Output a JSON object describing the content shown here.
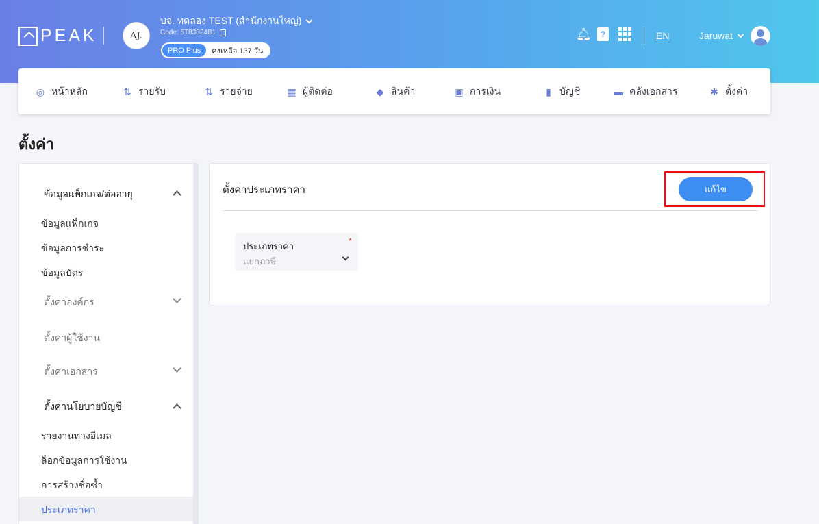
{
  "header": {
    "logo_text": "PEAK",
    "company_initials": "AJ.",
    "company_name": "บจ. ทดลอง TEST (สำนักงานใหญ่)",
    "company_code": "Code: 5T83824B1",
    "plan_badge": "PRO Plus",
    "plan_remaining": "คงเหลือ 137 วัน",
    "book_glyph": "?",
    "language": "EN",
    "username": "Jaruwat"
  },
  "nav": {
    "items": [
      {
        "label": "หน้าหลัก",
        "icon": "dashboard-icon",
        "glyph": "◎"
      },
      {
        "label": "รายรับ",
        "icon": "income-icon",
        "glyph": "⇅"
      },
      {
        "label": "รายจ่าย",
        "icon": "expense-icon",
        "glyph": "⇅"
      },
      {
        "label": "ผู้ติดต่อ",
        "icon": "contacts-icon",
        "glyph": "▦"
      },
      {
        "label": "สินค้า",
        "icon": "product-box-icon",
        "glyph": "◆"
      },
      {
        "label": "การเงิน",
        "icon": "money-icon",
        "glyph": "▣"
      },
      {
        "label": "บัญชี",
        "icon": "accounting-book-icon",
        "glyph": "▮"
      },
      {
        "label": "คลังเอกสาร",
        "icon": "folder-icon",
        "glyph": "▬"
      },
      {
        "label": "ตั้งค่า",
        "icon": "gear-icon",
        "glyph": "✱"
      }
    ]
  },
  "page": {
    "title": "ตั้งค่า"
  },
  "sidebar": {
    "groups": [
      {
        "label": "ข้อมูลแพ็กเกจ/ต่ออายุ",
        "expanded": true
      },
      {
        "label": "ตั้งค่าองค์กร",
        "expanded": false
      },
      {
        "label": "ตั้งค่าผู้ใช้งาน",
        "expanded": false
      },
      {
        "label": "ตั้งค่าเอกสาร",
        "expanded": false
      },
      {
        "label": "ตั้งค่านโยบายบัญชี",
        "expanded": true
      }
    ],
    "items": [
      {
        "label": "ข้อมูลแพ็กเกจ"
      },
      {
        "label": "ข้อมูลการชำระ"
      },
      {
        "label": "ข้อมูลบัตร"
      },
      {
        "label": "รายงานทางอีเมล"
      },
      {
        "label": "ล็อกข้อมูลการใช้งาน"
      },
      {
        "label": "การสร้างชื่อซ้ำ"
      },
      {
        "label": "ประเภทราคา",
        "active": true
      }
    ]
  },
  "card": {
    "title": "ตั้งค่าประเภทราคา",
    "edit_button": "แก้ไข",
    "field": {
      "label": "ประเภทราคา",
      "required_mark": "*",
      "value": "แยกภาษี"
    }
  },
  "colors": {
    "accent": "#3d8ef0",
    "highlight_box": "#ee1111",
    "active_link": "#4a6ee0"
  }
}
